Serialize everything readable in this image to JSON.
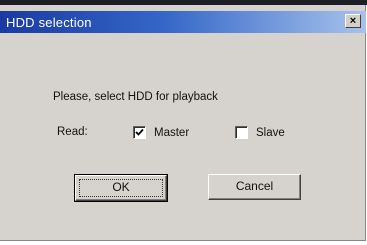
{
  "dialog": {
    "title": "HDD selection",
    "close_glyph": "×",
    "close_icon": "close-icon",
    "prompt": "Please, select HDD for playback",
    "read_label": "Read:",
    "options": [
      {
        "label": "Master",
        "checked": true
      },
      {
        "label": "Slave",
        "checked": false
      }
    ],
    "ok_label": "OK",
    "cancel_label": "Cancel"
  },
  "colors": {
    "titlebar_start": "#1a3aa0",
    "titlebar_end": "#a7c3ec",
    "face": "#d6d3ce"
  }
}
